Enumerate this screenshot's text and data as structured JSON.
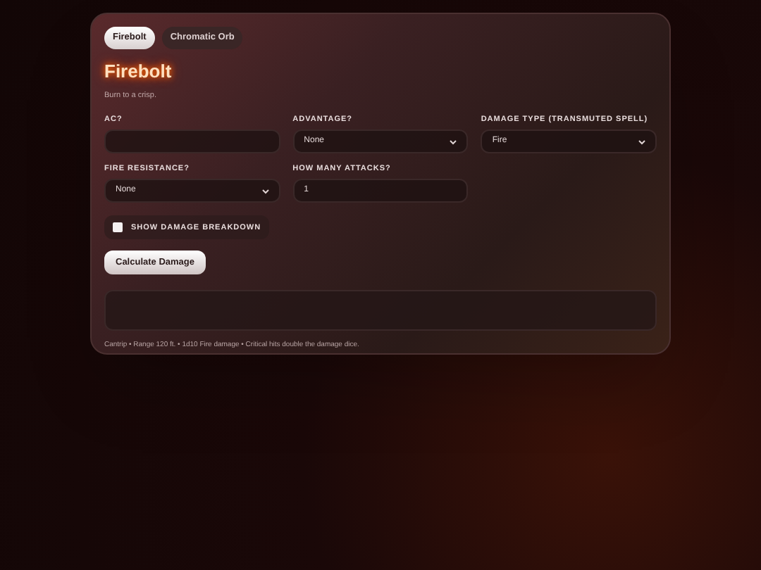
{
  "tabs": [
    {
      "label": "Firebolt",
      "selected": true
    },
    {
      "label": "Chromatic Orb",
      "selected": false
    }
  ],
  "title": "Firebolt",
  "subtitle": "Burn to a crisp.",
  "fields": [
    {
      "kind": "input",
      "label": "AC?"
    },
    {
      "kind": "select",
      "label": "ADVANTAGE?",
      "value": "None"
    },
    {
      "kind": "select",
      "label": "DAMAGE TYPE (TRANSMUTED SPELL)",
      "value": "Fire"
    },
    {
      "kind": "select",
      "label": "FIRE RESISTANCE?",
      "value": "None"
    },
    {
      "kind": "input",
      "label": "HOW MANY ATTACKS?",
      "value": "1"
    }
  ],
  "breakdown_toggle": {
    "label": "SHOW DAMAGE BREAKDOWN",
    "checked": false
  },
  "calculate_button": "Calculate Damage",
  "footer": "Cantrip • Range 120 ft. • 1d10 Fire damage • Critical hits double the damage dice."
}
